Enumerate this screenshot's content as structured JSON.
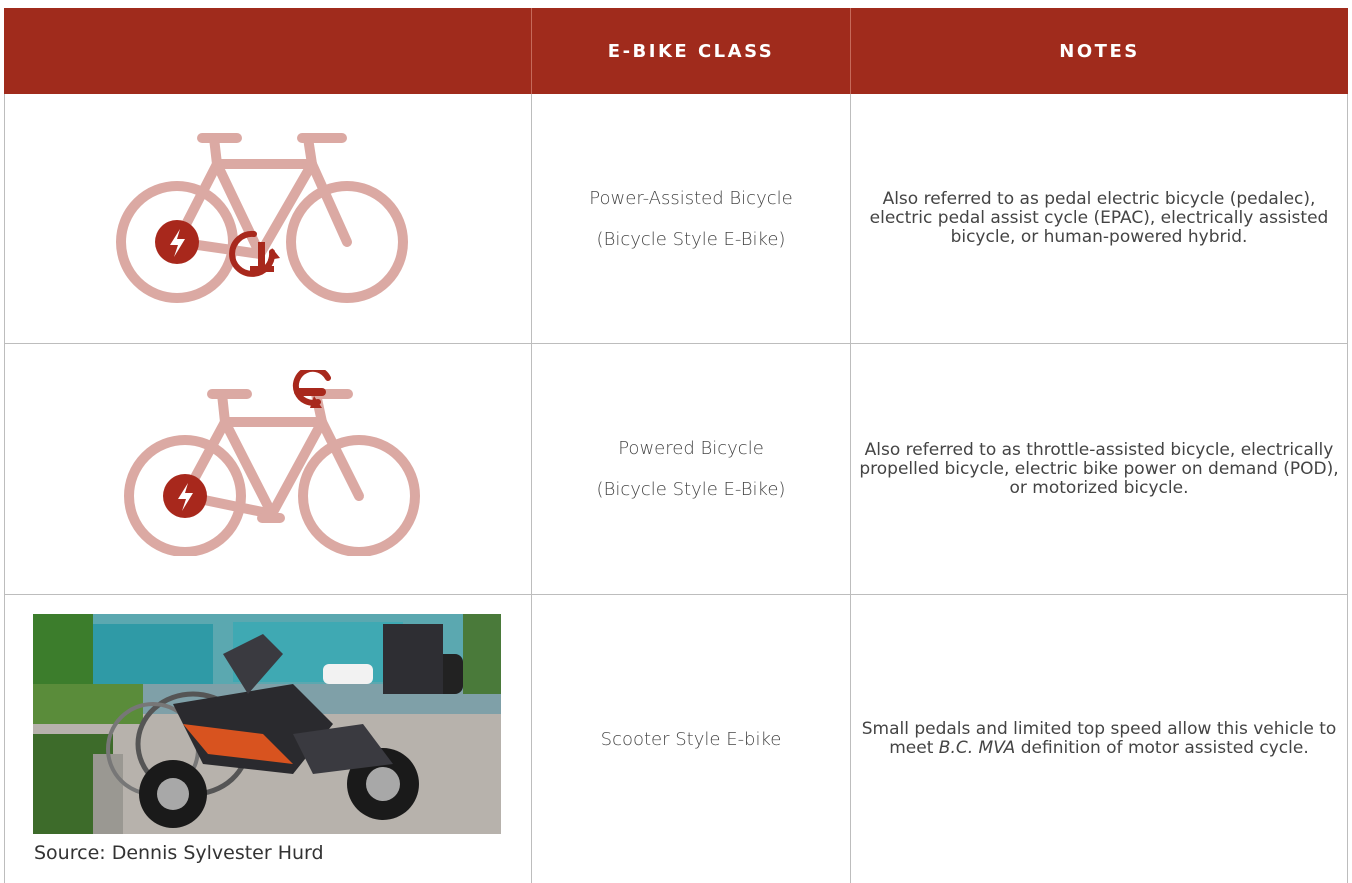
{
  "header": {
    "col_image": "",
    "col_class": "E-BIKE CLASS",
    "col_notes": "NOTES"
  },
  "rows": [
    {
      "class_line1": "Power-Assisted Bicycle",
      "class_line2": "(Bicycle Style E-Bike)",
      "notes": "Also referred to as pedal electric bicycle (pedalec), electric pedal assist cycle (EPAC), electrically assisted bicycle, or human-powered hybrid.",
      "icon": "pedal-assist-bicycle-icon"
    },
    {
      "class_line1": "Powered Bicycle",
      "class_line2": "(Bicycle Style E-Bike)",
      "notes": "Also referred to as throttle-assisted bicycle, electrically propelled bicycle, electric bike power on demand (POD), or motorized bicycle.",
      "icon": "throttle-bicycle-icon"
    },
    {
      "class_line1": "Scooter Style E-bike",
      "notes_prefix": "Small pedals and limited top speed allow this vehicle to meet ",
      "notes_italic": "B.C. MVA",
      "notes_suffix": " definition of motor assisted cycle.",
      "photo_caption": "Source: Dennis Sylvester Hurd"
    }
  ],
  "colors": {
    "header_bg": "#a02b1c",
    "icon_light": "#dba9a3",
    "icon_dark": "#a8281c",
    "grid": "#bdbdbd"
  }
}
